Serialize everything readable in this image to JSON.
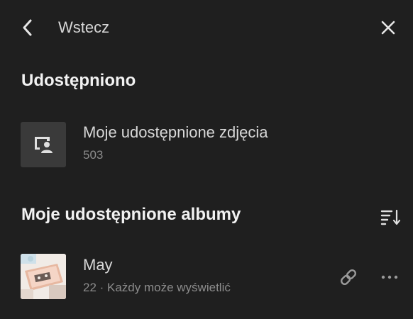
{
  "header": {
    "back_label": "Wstecz",
    "back_icon": "chevron-left-icon",
    "close_icon": "close-icon"
  },
  "shared_section": {
    "title": "Udostępniono",
    "item": {
      "title": "Moje udostępnione zdjęcia",
      "count": "503",
      "icon": "shared-photo-icon"
    }
  },
  "albums_section": {
    "title": "Moje udostępnione albumy",
    "sort_icon": "sort-icon",
    "albums": [
      {
        "title": "May",
        "subtitle": "22 · Każdy może wyświetlić",
        "link_icon": "link-icon",
        "more_icon": "more-icon"
      }
    ]
  },
  "colors": {
    "background": "#1f1f1f",
    "text_primary": "#f2f2f2",
    "text_secondary": "#8c8c8c",
    "icon_muted": "#9a9a9a",
    "placeholder_bg": "#3a3a3a"
  }
}
